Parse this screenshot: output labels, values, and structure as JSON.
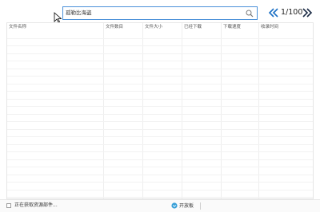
{
  "search": {
    "value": "孤勒比海盗"
  },
  "pager": {
    "text": "1/100"
  },
  "table": {
    "columns": [
      "文件名称",
      "文件数目",
      "文件大小",
      "已经下载",
      "下载速度",
      "收录时间"
    ],
    "row_count": 24
  },
  "status": {
    "text": "正在获取资源部件...",
    "open_button": "开放板"
  },
  "colors": {
    "accent": "#1a6fc4",
    "search_border": "#4a90d9",
    "open_icon": "#3aa0d8"
  },
  "icons": {
    "search": "search-icon",
    "prev": "double-chevron-left-icon",
    "next": "double-chevron-right-icon",
    "cursor": "mouse-cursor-icon",
    "status": "status-box-icon",
    "open": "open-icon"
  }
}
